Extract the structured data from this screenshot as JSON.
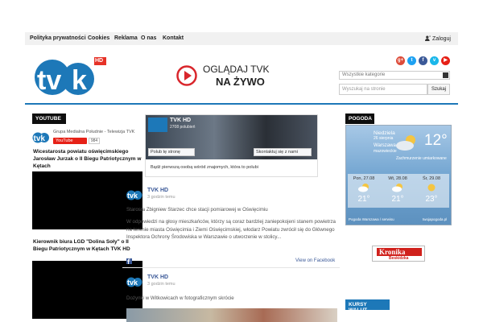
{
  "topnav": {
    "items": [
      "Polityka prywatności",
      "Cookies",
      "Reklama",
      "O nas",
      "Kontakt"
    ],
    "login": "Zaloguj"
  },
  "header": {
    "promo_line1": "OGLĄDAJ TVK",
    "promo_line2": "NA ŻYWO",
    "logo_badge": "HD",
    "search": {
      "category_placeholder": "Wszystkie kategorie",
      "placeholder": "Wyszukaj na stronie",
      "button": "Szukaj"
    }
  },
  "youtube": {
    "heading": "YOUTUBE",
    "channel_name": "Grupa Medialna Południe - Telewizja TVK",
    "button": "YouTube",
    "count": "984",
    "videos": [
      {
        "title": "Wicestarosta powiatu oświęcimskiego Jarosław Jurzak o II Biegu Patriotycznym w Kętach"
      },
      {
        "title": "Kierownik biura LGD \"Dolina Soły\" o II Biegu Patriotycznym w Kętach TVK HD"
      }
    ]
  },
  "facebook": {
    "page_name": "TVK HD",
    "likes": "2708 polubień",
    "like_btn": "Polub tę stronę",
    "contact_btn": "Skontaktuj się z nami",
    "first_text": "Bądź pierwszą osobą wśród znajomych, która to polubi",
    "view_on": "View on Facebook",
    "posts": [
      {
        "author": "TVK HD",
        "time": "3 godzin temu",
        "headline": "Starosta Zbigniew Starzec chce stacji pomiarowej w Oświęcimiu",
        "body": "W odpowiedzi na głosy mieszkańców, którzy są coraz bardziej zaniepokojeni stanem powietrza na terenie miasta Oświęcimia i Ziemi Oświęcimskiej, włodarz Powiatu zwrócił się do Głównego Inspektora Ochrony Środowiska w Warszawie o utworzenie w stolicy..."
      },
      {
        "author": "TVK HD",
        "time": "3 godzin temu",
        "headline": "Dożynki w Witkowicach w fotograficznym skrócie"
      }
    ]
  },
  "weather": {
    "heading": "POGODA",
    "day": "Niedziela",
    "date": "26 sierpnia",
    "city": "Warszawa",
    "region": "mazowieckie",
    "condition": "Zachmurzenie umiarkowane",
    "temp": "12°",
    "forecast": [
      {
        "day": "Pon, 27.08",
        "temp": "21°"
      },
      {
        "day": "Wt, 28.08",
        "temp": "21°"
      },
      {
        "day": "Śr, 29.08",
        "temp": "23°"
      }
    ],
    "footer": "Pogoda Warszawa / serwisu",
    "brand": "twojapogoda.pl"
  },
  "kronika": {
    "line1": "Kronika",
    "line2": "Beskidzka"
  },
  "kursy": {
    "heading": "KURSY WALUT"
  },
  "colors": {
    "accent": "#1d78b8",
    "dark": "#0e0e0e",
    "fb": "#3b5998",
    "yt": "#e62117"
  },
  "icons": [
    "google-plus-icon",
    "twitter-icon",
    "facebook-icon",
    "vimeo-icon",
    "youtube-icon",
    "user-icon",
    "play-icon"
  ]
}
